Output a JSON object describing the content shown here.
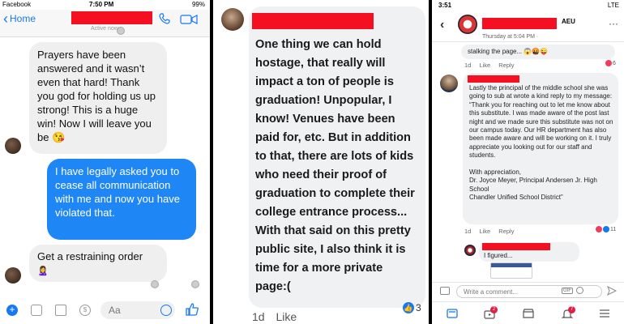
{
  "messenger": {
    "status": {
      "carrier": "Facebook",
      "time": "7:50 PM",
      "battery": "99%"
    },
    "nav": {
      "back_label": "Home",
      "subtitle": "Active now"
    },
    "messages": [
      {
        "dir": "in",
        "text": "Prayers have been answered and it wasn’t even that hard! Thank you god for holding us up strong! This is a huge win! Now I will leave you be 😘"
      },
      {
        "dir": "out",
        "text": "I have legally asked you to cease all communication with me and now you have violated that."
      },
      {
        "dir": "in",
        "text": "Get a restraining order"
      }
    ],
    "composer": {
      "placeholder": "Aa"
    }
  },
  "comment": {
    "text": "One thing we can hold hostage, that really will impact a ton of people is graduation! Unpopular, I know! Venues have been paid for, etc. But in addition to that, there are lots of kids who need their proof of graduation to complete their college entrance process... With that said on this pretty public site, I also think it is time for a more private page:(",
    "time": "1d",
    "like_label": "Like",
    "reaction_count": "3"
  },
  "group": {
    "status": {
      "time": "3:51",
      "network": "LTE"
    },
    "header": {
      "group_name": "AEU",
      "date": "Thursday at 5:04 PM ·"
    },
    "comments": [
      {
        "text": "stalking the page... 😱🤬😜",
        "time": "1d",
        "like": "Like",
        "reply": "Reply",
        "reactions": "6"
      },
      {
        "text": "Lastly the principal of the middle school she was going to sub at wrote a kind reply to my message:\n“Thank you for reaching out to let me know about this substitute. I was made aware of the post last night and we made sure this substitute was not on our campus today. Our HR department has also been made aware and will be working on it. I truly appreciate you looking out for our staff and students.\n\nWith appreciation,\nDr. Joyce Meyer, Principal Andersen Jr. High School\nChandler Unified School District”",
        "time": "1d",
        "like": "Like",
        "reply": "Reply",
        "reactions": "11"
      },
      {
        "text": "I figured..."
      }
    ],
    "write_placeholder": "Write a comment...",
    "gif_label": "GIF",
    "tabs": [
      {
        "icon": "news-feed-icon"
      },
      {
        "icon": "watch-icon",
        "badge": "2"
      },
      {
        "icon": "marketplace-icon"
      },
      {
        "icon": "notifications-icon",
        "badge": "7"
      },
      {
        "icon": "menu-icon"
      }
    ],
    "colors": {
      "fb_blue": "#1778f2",
      "badge_red": "#e41e3f"
    }
  }
}
